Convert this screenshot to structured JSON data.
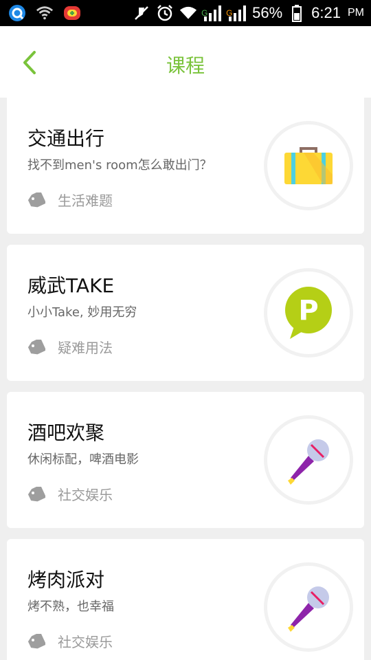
{
  "status_bar": {
    "battery_percent": "56%",
    "time": "6:21",
    "ampm": "PM",
    "signal_1_label": "G",
    "signal_2_label": "G",
    "icons": [
      "q-app-icon",
      "wifi-question-icon",
      "game-app-icon",
      "mute-icon",
      "alarm-icon",
      "wifi-icon",
      "signal-icon",
      "signal-icon",
      "battery-icon"
    ]
  },
  "header": {
    "title": "课程",
    "accent_color": "#7ac33b"
  },
  "cards": [
    {
      "title": "交通出行",
      "subtitle": "找不到men's room怎么敢出门？",
      "tag": "生活难题",
      "icon": "suitcase-icon"
    },
    {
      "title": "威武TAKE",
      "subtitle": "小小Take, 妙用无穷",
      "tag": "疑难用法",
      "icon": "parking-p-icon"
    },
    {
      "title": "酒吧欢聚",
      "subtitle": "休闲标配，啤酒电影",
      "tag": "社交娱乐",
      "icon": "microphone-icon"
    },
    {
      "title": "烤肉派对",
      "subtitle": "烤不熟，也幸福",
      "tag": "社交娱乐",
      "icon": "microphone-icon"
    }
  ]
}
